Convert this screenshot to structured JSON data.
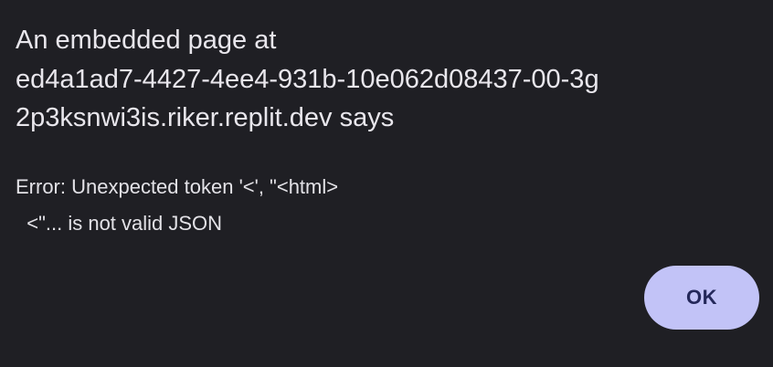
{
  "dialog": {
    "title": "An embedded page at\ned4a1ad7-4427-4ee4-931b-10e062d08437-00-3g\n2p3ksnwi3is.riker.replit.dev says",
    "message": "Error: Unexpected token '<', \"<html>\n  <\"... is not valid JSON",
    "ok_label": "OK"
  },
  "colors": {
    "background": "#1f1f24",
    "text": "#e8e6ec",
    "button_bg": "#c2c3f7",
    "button_text": "#24285a"
  }
}
